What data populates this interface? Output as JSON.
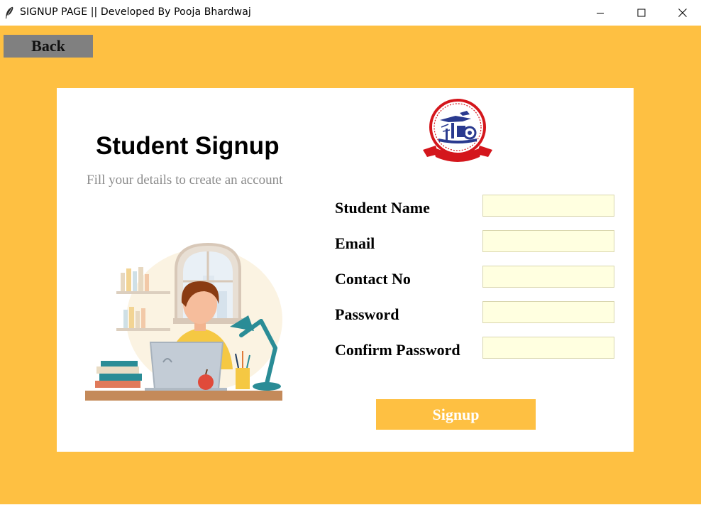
{
  "window": {
    "title": "SIGNUP PAGE || Developed By Pooja Bhardwaj",
    "icon": "feather-icon",
    "controls": [
      "minimize-icon",
      "maximize-icon",
      "close-icon"
    ]
  },
  "colors": {
    "background": "#fec042",
    "card": "#ffffff",
    "back_button": "#808080",
    "input_fill": "#ffffe0",
    "signup_button": "#fec042",
    "signup_text": "#ffffff",
    "subheading_text": "#8a8a8a",
    "logo_red": "#d4161c",
    "logo_blue": "#2a3a8f"
  },
  "back_button": {
    "label": "Back"
  },
  "heading": "Student Signup",
  "subheading": "Fill your details to create an account",
  "logo": {
    "icon": "college-emblem-icon",
    "text_top": "GURU NANAK DEV",
    "text_year": "1969",
    "text_bottom": "NDEC COLLEGE"
  },
  "illustration": {
    "icon": "student-with-laptop-illustration"
  },
  "form": {
    "fields": [
      {
        "label": "Student Name",
        "value": "",
        "placeholder": ""
      },
      {
        "label": "Email",
        "value": "",
        "placeholder": ""
      },
      {
        "label": "Contact No",
        "value": "",
        "placeholder": ""
      },
      {
        "label": "Password",
        "value": "",
        "placeholder": ""
      },
      {
        "label": "Confirm Password",
        "value": "",
        "placeholder": ""
      }
    ],
    "submit_label": "Signup"
  }
}
